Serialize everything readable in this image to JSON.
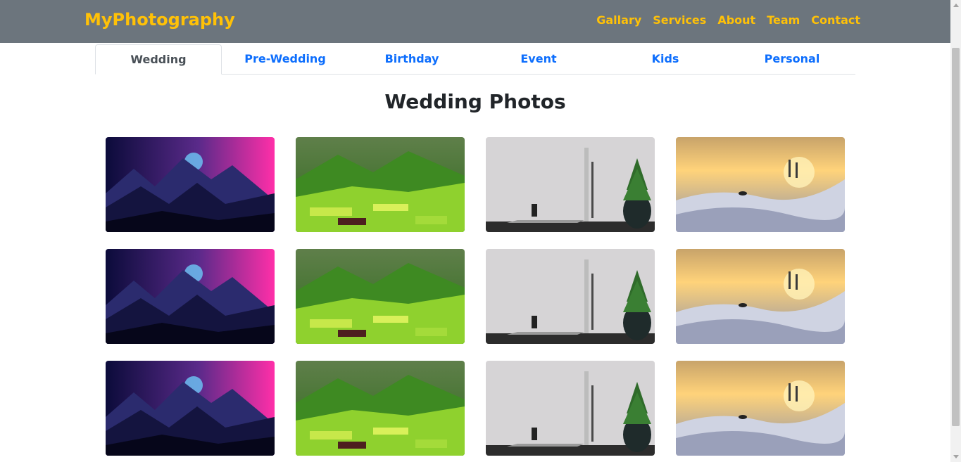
{
  "navbar": {
    "brand": "MyPhotography",
    "links": [
      "Gallary",
      "Services",
      "About",
      "Team",
      "Contact"
    ]
  },
  "tabs": [
    "Wedding",
    "Pre-Wedding",
    "Birthday",
    "Event",
    "Kids",
    "Personal"
  ],
  "active_tab": "Wedding",
  "heading": "Wedding Photos",
  "gallery": {
    "rows": 3,
    "photos": [
      "mountain-night",
      "green-valley",
      "laptop-desk",
      "snow-sunrise"
    ]
  },
  "colors": {
    "navbar_bg": "#6c757d",
    "brand": "#ffc107",
    "tab_link": "#0d6efd",
    "tab_active": "#495057"
  }
}
